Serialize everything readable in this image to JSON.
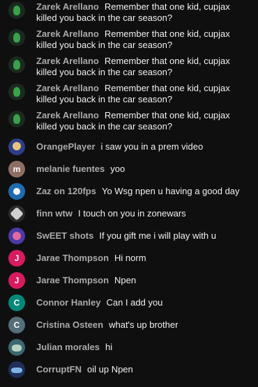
{
  "messages": [
    {
      "author": "Zarek Arellano",
      "text": "Remember that one kid, cupjax killed you back in the car season?",
      "avatar": {
        "icon": "green-character-avatar-icon",
        "color": "#3aa14b"
      }
    },
    {
      "author": "Zarek Arellano",
      "text": "Remember that one kid, cupjax killed you back in the car season?",
      "avatar": {
        "icon": "green-character-avatar-icon",
        "color": "#3aa14b"
      }
    },
    {
      "author": "Zarek Arellano",
      "text": "Remember that one kid, cupjax killed you back in the car season?",
      "avatar": {
        "icon": "green-character-avatar-icon",
        "color": "#3aa14b"
      }
    },
    {
      "author": "Zarek Arellano",
      "text": "Remember that one kid, cupjax killed you back in the car season?",
      "avatar": {
        "icon": "green-character-avatar-icon",
        "color": "#3aa14b"
      }
    },
    {
      "author": "Zarek Arellano",
      "text": "Remember that one kid, cupjax killed you back in the car season?",
      "avatar": {
        "icon": "green-character-avatar-icon",
        "color": "#3aa14b"
      }
    },
    {
      "author": "OrangePlayer",
      "text": "i saw you in a prem video",
      "avatar": {
        "icon": "character-avatar-icon",
        "color": "#2c3e8a"
      }
    },
    {
      "author": "melanie fuentes",
      "text": "yoo",
      "avatar": {
        "letter": "m",
        "color": "#8d6e63"
      }
    },
    {
      "author": "Zaz on 120fps",
      "text": "Yo Wsg npen u having a good day",
      "avatar": {
        "icon": "character-avatar-icon",
        "color": "#1e6bb0"
      }
    },
    {
      "author": "finn wtw",
      "text": "I touch on you in zonewars",
      "avatar": {
        "icon": "gray-emblem-avatar-icon",
        "color": "#cfcfcf"
      }
    },
    {
      "author": "SwEET shots",
      "text": "If you gift me i will play with u",
      "avatar": {
        "icon": "character-avatar-icon",
        "color": "#4b3aa8"
      }
    },
    {
      "author": "Jarae Thompson",
      "text": "Hi norm",
      "avatar": {
        "letter": "J",
        "color": "#d81b60"
      }
    },
    {
      "author": "Jarae Thompson",
      "text": "Npen",
      "avatar": {
        "letter": "J",
        "color": "#d81b60"
      }
    },
    {
      "author": "Connor Hanley",
      "text": "Can I add you",
      "avatar": {
        "letter": "C",
        "color": "#00897b"
      }
    },
    {
      "author": "Cristina Osteen",
      "text": "what's up brother",
      "avatar": {
        "letter": "C",
        "color": "#546e7a"
      }
    },
    {
      "author": "Julian morales",
      "text": "hi",
      "avatar": {
        "icon": "photo-avatar-icon",
        "color": "#3c6770"
      }
    },
    {
      "author": "CorruptFN",
      "text": "oil up Npen",
      "avatar": {
        "icon": "photo-avatar-icon",
        "color": "#1e2f5a"
      }
    }
  ]
}
